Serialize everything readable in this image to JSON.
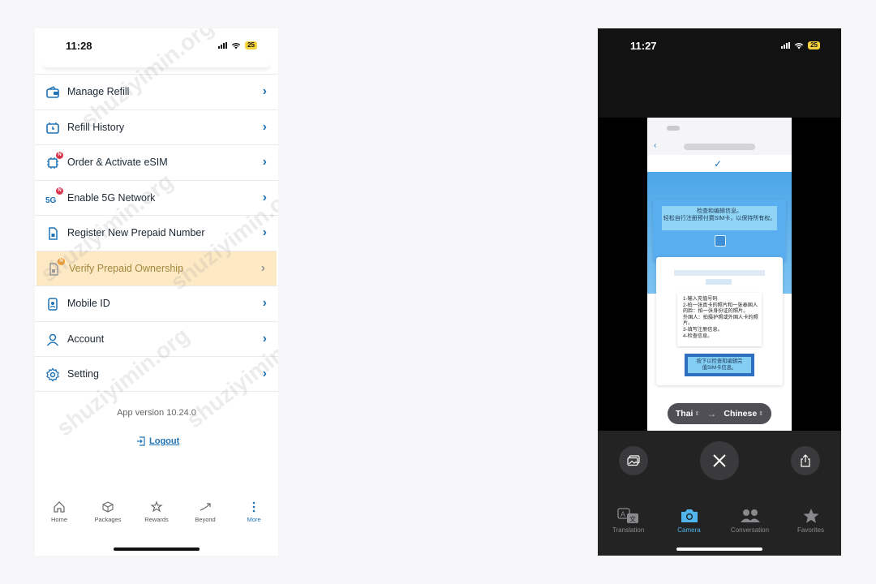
{
  "left_phone": {
    "status": {
      "time": "11:28",
      "battery": "25"
    },
    "menu": [
      {
        "label": "Manage Refill",
        "icon": "wallet-icon",
        "badge": ""
      },
      {
        "label": "Refill History",
        "icon": "history-icon",
        "badge": ""
      },
      {
        "label": "Order & Activate eSIM",
        "icon": "esim-chip-icon",
        "badge": "N"
      },
      {
        "label": "Enable 5G Network",
        "icon": "5g-icon",
        "badge": "N"
      },
      {
        "label": "Register New Prepaid Number",
        "icon": "sim-card-icon",
        "badge": ""
      },
      {
        "label": "Verify Prepaid Ownership",
        "icon": "verify-sim-icon",
        "badge": "N"
      },
      {
        "label": "Mobile ID",
        "icon": "mobile-id-icon",
        "badge": ""
      },
      {
        "label": "Account",
        "icon": "person-icon",
        "badge": ""
      },
      {
        "label": "Setting",
        "icon": "gear-icon",
        "badge": ""
      }
    ],
    "app_version": "App version 10.24.0",
    "logout_label": "Logout",
    "tabs": [
      {
        "label": "Home",
        "icon": "home-icon"
      },
      {
        "label": "Packages",
        "icon": "package-icon"
      },
      {
        "label": "Rewards",
        "icon": "rewards-icon"
      },
      {
        "label": "Beyond",
        "icon": "beyond-icon"
      },
      {
        "label": "More",
        "icon": "more-dots-icon"
      }
    ],
    "active_tab": "More",
    "highlighted_item": "Verify Prepaid Ownership",
    "watermark": "shuziyimin.org"
  },
  "right_phone": {
    "status": {
      "time": "11:27",
      "battery": "25"
    },
    "translated_screenshot": {
      "hero_text": "检查和编辑信息。\n轻松自行注册预付费SIM卡，以保持所有权。",
      "steps_text": "1-输入充值号码\n2-拍一张真卡的照片和一张泰国人的脸：拍一张身份证的照片。\n外国人：拍摄护照或外国人卡的照片。\n3-填写注册信息。\n4-检查信息。",
      "cta_text": "按下以检查和编辑完\n值SIM卡信息。"
    },
    "source_lang": "Thai",
    "target_lang": "Chinese",
    "tabs": [
      {
        "label": "Translation",
        "icon": "translate-icon"
      },
      {
        "label": "Camera",
        "icon": "camera-icon"
      },
      {
        "label": "Conversation",
        "icon": "people-icon"
      },
      {
        "label": "Favorites",
        "icon": "star-icon"
      }
    ],
    "active_tab": "Camera"
  },
  "colors": {
    "accent_blue": "#1f73b7",
    "highlight_bg": "#fde9c4",
    "badge_red": "#d8364e",
    "camera_active": "#4fb5ec"
  }
}
